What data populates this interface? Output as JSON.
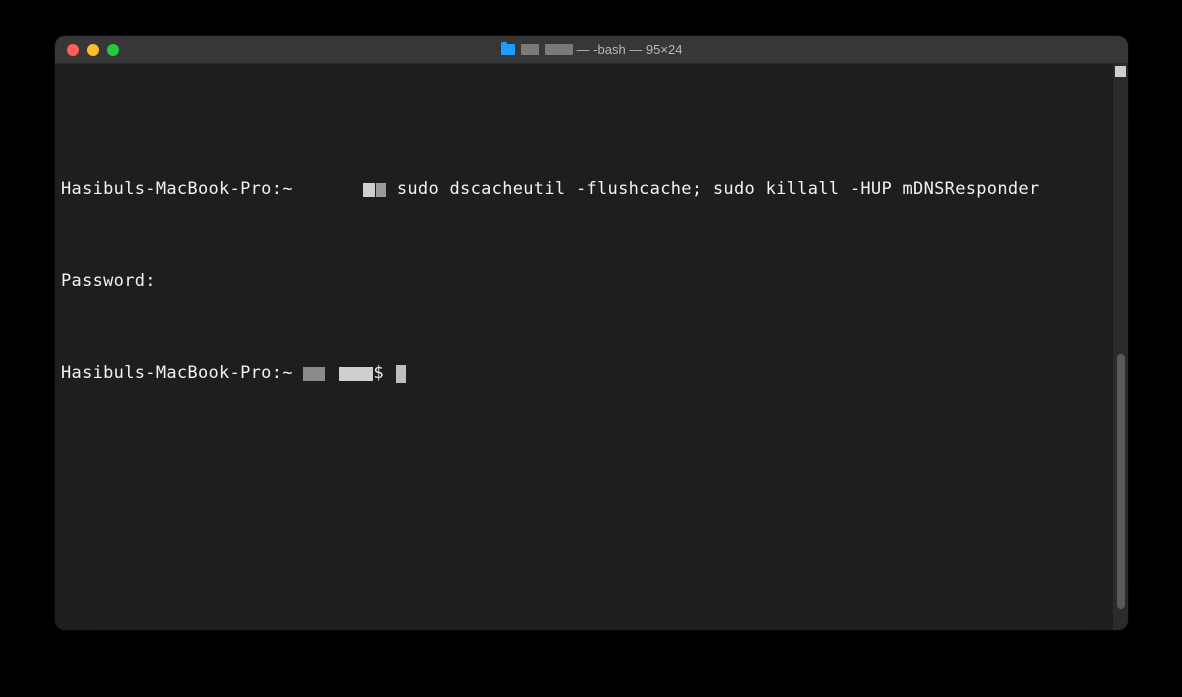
{
  "titlebar": {
    "title_suffix": " — -bash — 95×24"
  },
  "terminal": {
    "line1_prompt_prefix": "Hasibuls-MacBook-Pro:~ ",
    "line1_command": " sudo dscacheutil -flushcache; sudo killall -HUP mDNSResponder",
    "line2": "Password:",
    "line3_prompt_prefix": "Hasibuls-MacBook-Pro:~ ",
    "line3_dollar": "$ "
  }
}
